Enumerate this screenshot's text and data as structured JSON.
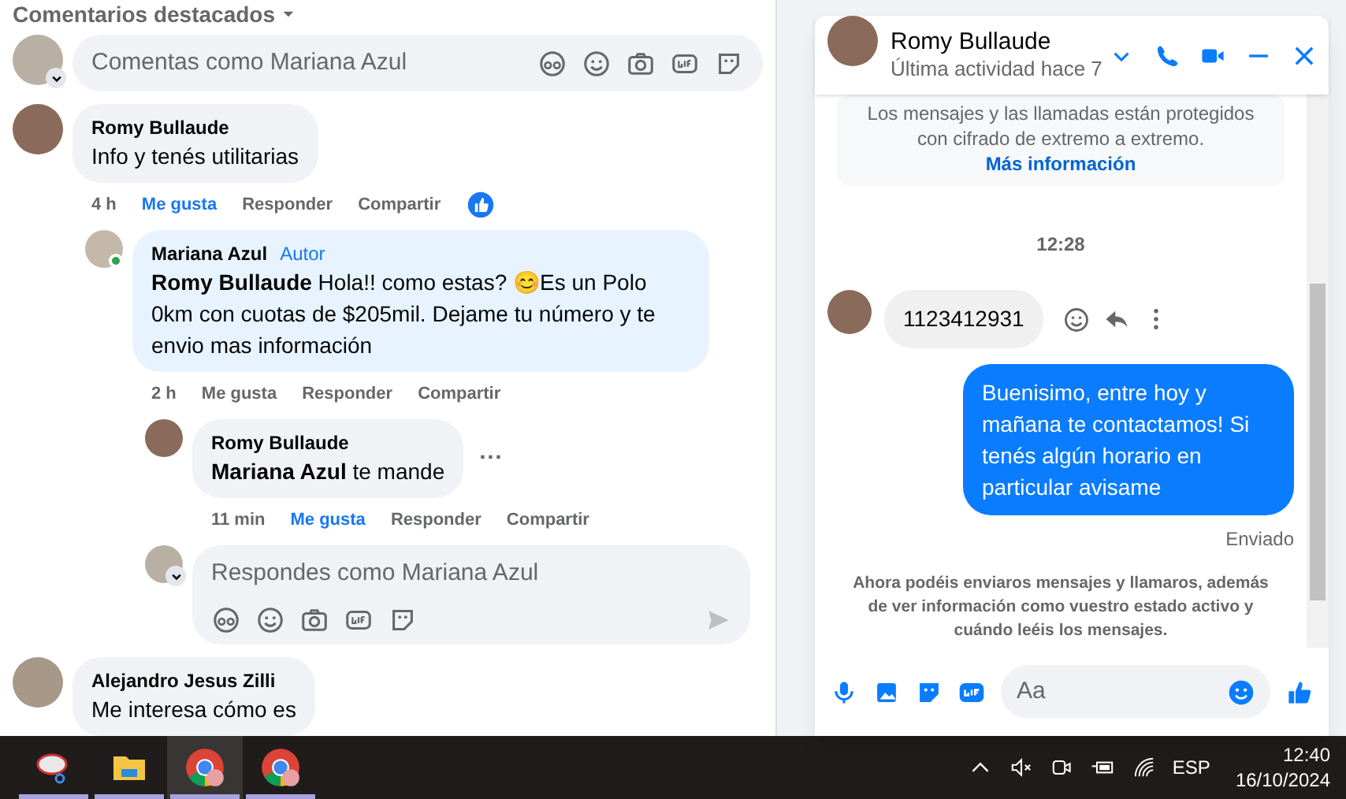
{
  "section_heading": "Comentarios destacados",
  "comment_box": {
    "placeholder": "Comentas como Mariana Azul"
  },
  "comments": [
    {
      "author": "Romy Bullaude",
      "text": "Info y tenés utilitarias",
      "time": "4 h",
      "like": "Me gusta",
      "liked": true,
      "reply": "Responder",
      "share": "Compartir",
      "reacted": true,
      "children": [
        {
          "author": "Mariana Azul",
          "badge": "Autor",
          "text": "**Romy Bullaude** Hola!! como estas? 😊Es un Polo 0km con cuotas de $205mil. Dejame tu número y te envio mas información",
          "time": "2 h",
          "like": "Me gusta",
          "liked": false,
          "reply": "Responder",
          "share": "Compartir",
          "online": true
        },
        {
          "author": "Romy Bullaude",
          "text": "**Mariana Azul** te mande",
          "time": "11 min",
          "like": "Me gusta",
          "liked": true,
          "reply": "Responder",
          "share": "Compartir",
          "more": "···"
        }
      ],
      "reply_box": {
        "placeholder": "Respondes como Mariana Azul"
      }
    },
    {
      "author": "Alejandro Jesus Zilli",
      "text": "Me interesa cómo es"
    }
  ],
  "chat": {
    "name": "Romy Bullaude",
    "status": "Última actividad hace 7",
    "notice": "Los mensajes y las llamadas están protegidos con cifrado de extremo a extremo.",
    "notice_link": "Más información",
    "time": "12:28",
    "messages": [
      {
        "kind": "incoming",
        "text": "1123412931"
      },
      {
        "kind": "outgoing",
        "text": "Buenisimo, entre hoy y mañana te contactamos! Si tenés algún horario en particular avisame"
      }
    ],
    "delivery": "Enviado",
    "info": "Ahora podéis enviaros mensajes y llamaros, además de ver información como vuestro estado activo y cuándo leéis los mensajes.",
    "composer": {
      "placeholder": "Aa"
    }
  },
  "taskbar": {
    "apps": [
      {
        "kind": "snip",
        "selected": false
      },
      {
        "kind": "folder",
        "selected": false
      },
      {
        "kind": "browser",
        "selected": true
      },
      {
        "kind": "browser",
        "selected": false
      }
    ],
    "language": "ESP",
    "time": "12:40",
    "date": "16/10/2024"
  }
}
